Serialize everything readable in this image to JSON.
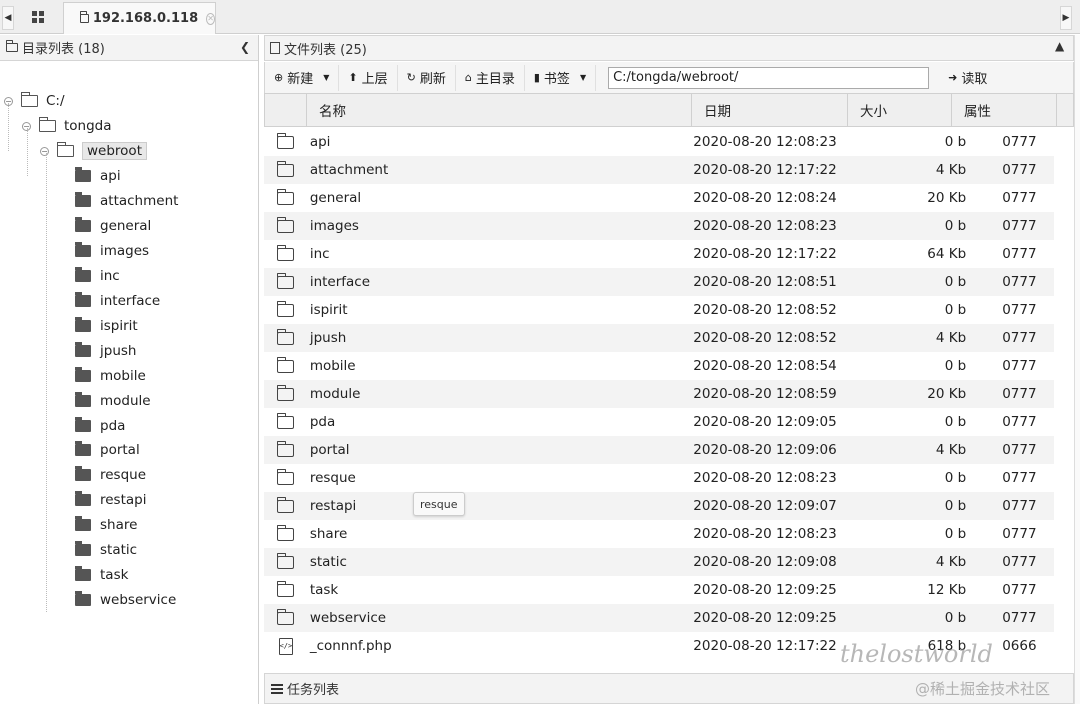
{
  "tabbar": {
    "tab_title": "192.168.0.118"
  },
  "left": {
    "header": "目录列表 (18)",
    "tree": {
      "root": "C:/",
      "level1": "tongda",
      "level2": "webroot",
      "children": [
        "api",
        "attachment",
        "general",
        "images",
        "inc",
        "interface",
        "ispirit",
        "jpush",
        "mobile",
        "module",
        "pda",
        "portal",
        "resque",
        "restapi",
        "share",
        "static",
        "task",
        "webservice"
      ]
    }
  },
  "right": {
    "header": "文件列表 (25)",
    "toolbar": {
      "new": "新建",
      "up": "上层",
      "refresh": "刷新",
      "home": "主目录",
      "bookmark": "书签",
      "path": "C:/tongda/webroot/",
      "read": "读取"
    },
    "columns": {
      "name": "名称",
      "date": "日期",
      "size": "大小",
      "attr": "属性"
    },
    "rows": [
      {
        "name": "api",
        "date": "2020-08-20 12:08:23",
        "size": "0 b",
        "attr": "0777",
        "type": "folder"
      },
      {
        "name": "attachment",
        "date": "2020-08-20 12:17:22",
        "size": "4 Kb",
        "attr": "0777",
        "type": "folder"
      },
      {
        "name": "general",
        "date": "2020-08-20 12:08:24",
        "size": "20 Kb",
        "attr": "0777",
        "type": "folder"
      },
      {
        "name": "images",
        "date": "2020-08-20 12:08:23",
        "size": "0 b",
        "attr": "0777",
        "type": "folder"
      },
      {
        "name": "inc",
        "date": "2020-08-20 12:17:22",
        "size": "64 Kb",
        "attr": "0777",
        "type": "folder"
      },
      {
        "name": "interface",
        "date": "2020-08-20 12:08:51",
        "size": "0 b",
        "attr": "0777",
        "type": "folder"
      },
      {
        "name": "ispirit",
        "date": "2020-08-20 12:08:52",
        "size": "0 b",
        "attr": "0777",
        "type": "folder"
      },
      {
        "name": "jpush",
        "date": "2020-08-20 12:08:52",
        "size": "4 Kb",
        "attr": "0777",
        "type": "folder"
      },
      {
        "name": "mobile",
        "date": "2020-08-20 12:08:54",
        "size": "0 b",
        "attr": "0777",
        "type": "folder"
      },
      {
        "name": "module",
        "date": "2020-08-20 12:08:59",
        "size": "20 Kb",
        "attr": "0777",
        "type": "folder"
      },
      {
        "name": "pda",
        "date": "2020-08-20 12:09:05",
        "size": "0 b",
        "attr": "0777",
        "type": "folder"
      },
      {
        "name": "portal",
        "date": "2020-08-20 12:09:06",
        "size": "4 Kb",
        "attr": "0777",
        "type": "folder"
      },
      {
        "name": "resque",
        "date": "2020-08-20 12:08:23",
        "size": "0 b",
        "attr": "0777",
        "type": "folder"
      },
      {
        "name": "restapi",
        "date": "2020-08-20 12:09:07",
        "size": "0 b",
        "attr": "0777",
        "type": "folder"
      },
      {
        "name": "share",
        "date": "2020-08-20 12:08:23",
        "size": "0 b",
        "attr": "0777",
        "type": "folder"
      },
      {
        "name": "static",
        "date": "2020-08-20 12:09:08",
        "size": "4 Kb",
        "attr": "0777",
        "type": "folder"
      },
      {
        "name": "task",
        "date": "2020-08-20 12:09:25",
        "size": "12 Kb",
        "attr": "0777",
        "type": "folder"
      },
      {
        "name": "webservice",
        "date": "2020-08-20 12:09:25",
        "size": "0 b",
        "attr": "0777",
        "type": "folder"
      },
      {
        "name": "_connnf.php",
        "date": "2020-08-20 12:17:22",
        "size": "618 b",
        "attr": "0666",
        "type": "file"
      }
    ],
    "tooltip": "resque"
  },
  "taskbar": {
    "label": "任务列表"
  },
  "watermark": {
    "line1": "thelostworld",
    "line2": "@稀土掘金技术社区"
  }
}
